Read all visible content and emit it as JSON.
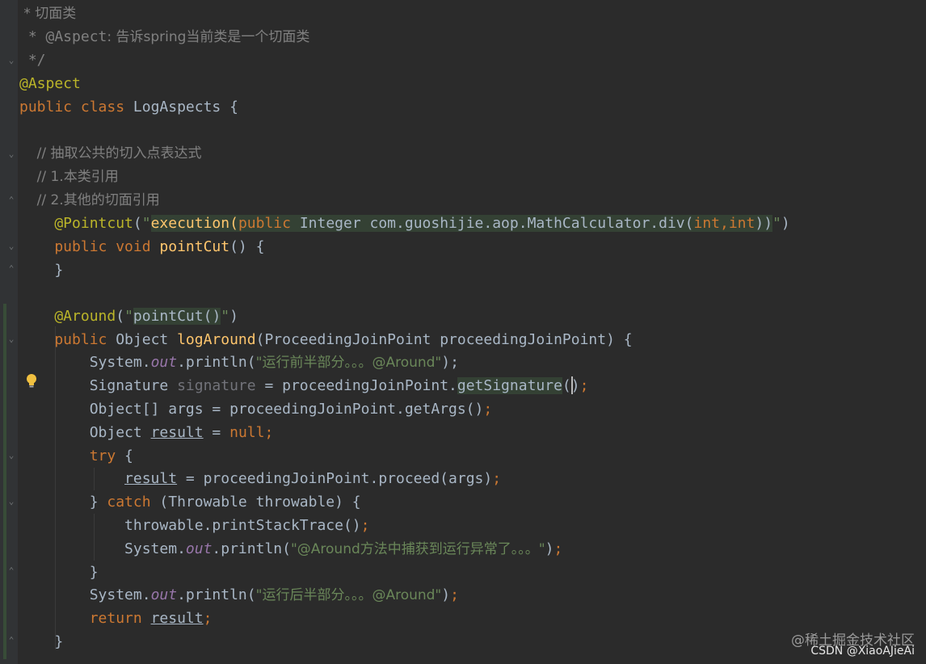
{
  "code": {
    "l1_text": " * 切面类",
    "l2_a": " * @Aspect",
    "l2_b": ": 告诉spring当前类是一个切面类",
    "l3": " */",
    "l4": "@Aspect",
    "l5_kw": "public class ",
    "l5_name": "LogAspects {",
    "l7": "    // 抽取公共的切入点表达式",
    "l8": "    // 1.本类引用",
    "l9": "    // 2.其他的切面引用",
    "l10_ann": "    @Pointcut",
    "l10_p1": "(",
    "l10_q": "\"",
    "l10_exec": "execution(",
    "l10_pub": "public ",
    "l10_rest": "Integer com.guoshijie.aop.MathCalculator.div(",
    "l10_int1": "int",
    "l10_comma": ",",
    "l10_int2": "int",
    "l10_close": "))",
    "l10_q2": "\"",
    "l10_p2": ")",
    "l11_kw": "    public void ",
    "l11_fn": "pointCut",
    "l11_rest": "() {",
    "l12": "    }",
    "l14_ann": "    @Around",
    "l14_p1": "(",
    "l14_q": "\"",
    "l14_ref": "pointCut()",
    "l14_q2": "\"",
    "l14_p2": ")",
    "l15_kw": "    public ",
    "l15_type": "Object ",
    "l15_fn": "logAround",
    "l15_rest": "(ProceedingJoinPoint proceedingJoinPoint) {",
    "l16_a": "        System.",
    "l16_out": "out",
    "l16_b": ".println(",
    "l16_str": "\"运行前半部分。。。@Around\"",
    "l16_c": ");",
    "l17_a": "        Signature ",
    "l17_var": "signature",
    "l17_b": " = proceedingJoinPoint.",
    "l17_call": "getSignature",
    "l17_c": "()",
    "l17_semi": ";",
    "l18_a": "        Object[] args = proceedingJoinPoint.getArgs()",
    "l18_semi": ";",
    "l19_a": "        Object ",
    "l19_var": "result",
    "l19_b": " = ",
    "l19_null": "null",
    "l19_semi": ";",
    "l20_kw": "        try",
    "l20_b": " {",
    "l21_a": "            ",
    "l21_var": "result",
    "l21_b": " = proceedingJoinPoint.proceed(args)",
    "l21_semi": ";",
    "l22_a": "        } ",
    "l22_kw": "catch",
    "l22_b": " (Throwable throwable) {",
    "l23_a": "            throwable.printStackTrace()",
    "l23_semi": ";",
    "l24_a": "            System.",
    "l24_out": "out",
    "l24_b": ".println(",
    "l24_str": "\"@Around方法中捕获到运行异常了。。。\"",
    "l24_c": ")",
    "l24_semi": ";",
    "l25": "        }",
    "l26_a": "        System.",
    "l26_out": "out",
    "l26_b": ".println(",
    "l26_str": "\"运行后半部分。。。@Around\"",
    "l26_c": ")",
    "l26_semi": ";",
    "l27_kw": "        return ",
    "l27_var": "result",
    "l27_semi": ";",
    "l28": "    }"
  },
  "watermark": {
    "line1": "@稀土掘金技术社区",
    "line2": "CSDN @XiaoAJieAi"
  },
  "colors": {
    "background": "#2b2b2b",
    "keyword": "#cc7832",
    "string": "#6a8759",
    "annotation": "#bbb529",
    "comment": "#808080",
    "method": "#ffc66d",
    "field": "#9876aa"
  }
}
